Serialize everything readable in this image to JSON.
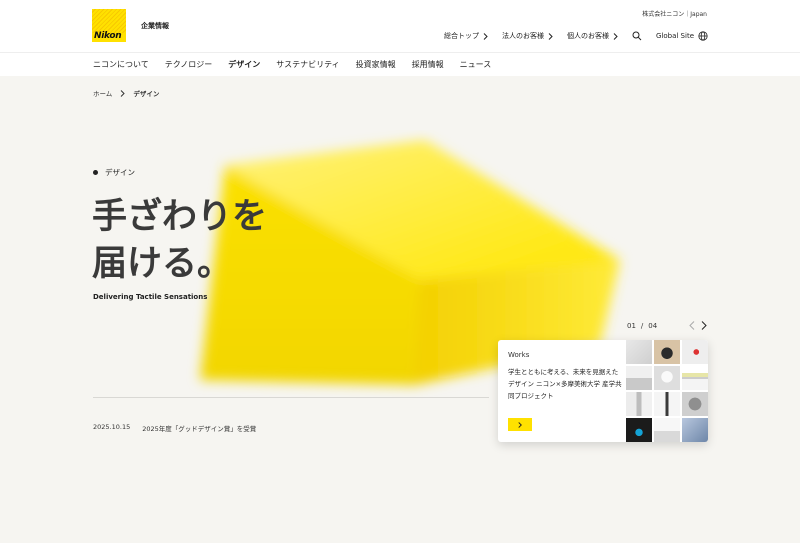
{
  "header": {
    "brand_text": "Nikon",
    "corporate_label": "企業情報",
    "util_top": "株式会社ニコン｜Japan",
    "util_nav": [
      {
        "label": "総合トップ"
      },
      {
        "label": "法人のお客様"
      },
      {
        "label": "個人のお客様"
      }
    ],
    "global_site": "Global Site"
  },
  "main_nav": {
    "items": [
      "ニコンについて",
      "テクノロジー",
      "デザイン",
      "サステナビリティ",
      "投資家情報",
      "採用情報",
      "ニュース"
    ],
    "active": "デザイン"
  },
  "breadcrumb": {
    "home": "ホーム",
    "current": "デザイン"
  },
  "hero": {
    "section_label": "デザイン",
    "title_line1": "手ざわりを",
    "title_line2": "届ける。",
    "subtitle": "Delivering Tactile Sensations"
  },
  "news": {
    "date": "2025.10.15",
    "title": "2025年度「グッドデザイン賞」を受賞"
  },
  "pager": {
    "current": "01",
    "separator": "/",
    "total": "04"
  },
  "works_card": {
    "tag": "Works",
    "description": "学生とともに考える、未来を見据えたデザイン ニコン×多摩美術大学 産学共同プロジェクト"
  },
  "colors": {
    "brand_yellow": "#ffe100",
    "background": "#f6f5f1"
  }
}
